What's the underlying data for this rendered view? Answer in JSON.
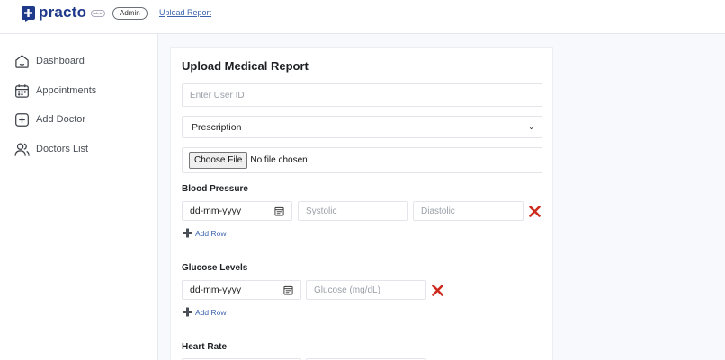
{
  "header": {
    "brand": "practo",
    "brand_tag": "Admin",
    "admin_badge": "Admin",
    "upload_link": "Upload Report"
  },
  "sidebar": {
    "items": [
      {
        "label": "Dashboard",
        "icon": "home-icon"
      },
      {
        "label": "Appointments",
        "icon": "calendar-icon"
      },
      {
        "label": "Add Doctor",
        "icon": "plus-square-icon"
      },
      {
        "label": "Doctors List",
        "icon": "users-icon"
      }
    ]
  },
  "form": {
    "title": "Upload Medical Report",
    "user_id_placeholder": "Enter User ID",
    "report_type": {
      "selected": "Prescription",
      "chevron": "⌄"
    },
    "file": {
      "button": "Choose File",
      "status": "No file chosen"
    },
    "blood_pressure": {
      "label": "Blood Pressure",
      "date_placeholder": "dd-mm-yyyy",
      "systolic_placeholder": "Systolic",
      "diastolic_placeholder": "Diastolic",
      "add_row": "Add Row"
    },
    "glucose": {
      "label": "Glucose Levels",
      "date_placeholder": "dd-mm-yyyy",
      "glucose_placeholder": "Glucose (mg/dL)",
      "add_row": "Add Row"
    },
    "heart_rate": {
      "label": "Heart Rate"
    }
  },
  "colors": {
    "brand": "#1f3a8a",
    "link": "#3c63ad",
    "remove": "#cc2b1d"
  }
}
